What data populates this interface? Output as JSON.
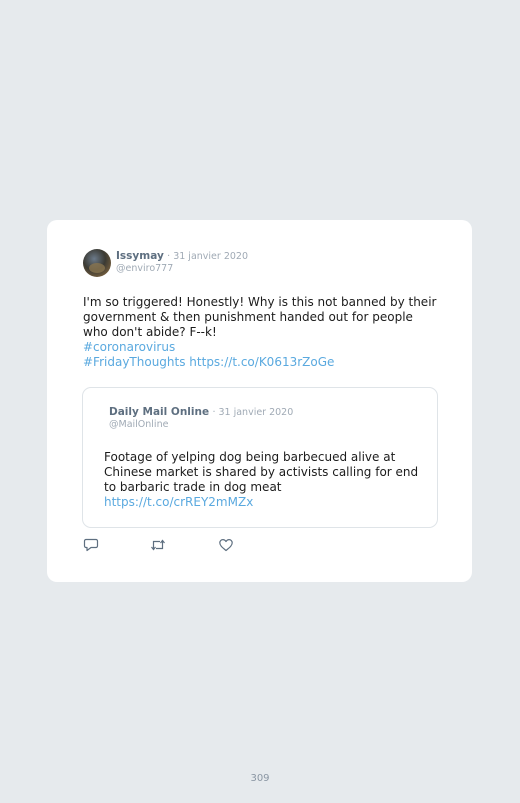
{
  "tweet": {
    "author_name": "Issymay",
    "date": "· 31 janvier 2020",
    "handle": "@enviro777",
    "text": "I'm so triggered! Honestly! Why is this not banned by their government & then punishment handed out for people who don't abide? F--k!",
    "hashtag_1": "#coronarovirus",
    "hashtag_2_and_link": "#FridayThoughts https://t.co/K0613rZoGe"
  },
  "quoted_tweet": {
    "author_name": "Daily Mail Online",
    "date": "· 31 janvier 2020",
    "handle": "@MailOnline",
    "text": "Footage of yelping dog being barbecued alive at Chinese market is shared by activists calling for end to barbaric trade in dog meat",
    "link": "https://t.co/crREY2mMZx"
  },
  "actions": [
    {
      "icon": "reply-icon"
    },
    {
      "icon": "retweet-icon"
    },
    {
      "icon": "like-icon"
    }
  ],
  "colors": {
    "background": "#e6eaed",
    "link": "#5aa9df",
    "name": "#5e6f80",
    "muted": "#a0aab5"
  },
  "page_number": "309"
}
